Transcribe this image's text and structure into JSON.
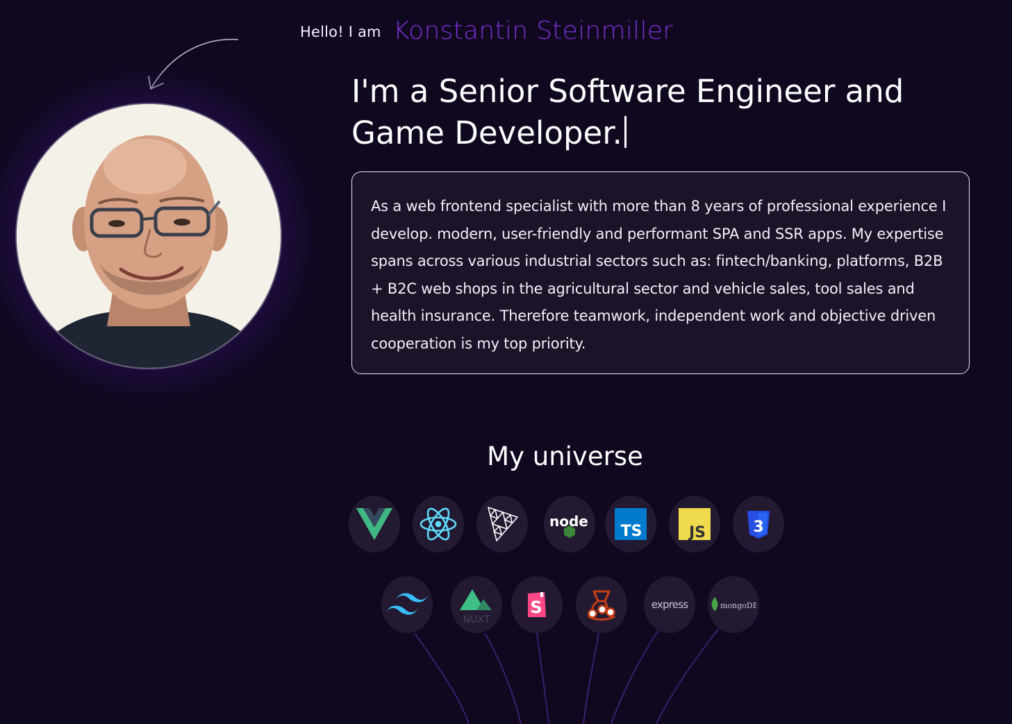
{
  "intro": {
    "greeting": "Hello! I am",
    "name": "Konstantin Steinmiller",
    "avatar_alt": "Portrait of Konstantin Steinmiller"
  },
  "headline": {
    "line1": "I'm a Senior Software Engineer and",
    "line2": "Game Developer."
  },
  "bio": {
    "text": "As a web frontend specialist with more than 8 years of professional experience I develop. modern, user-friendly and performant SPA and SSR apps. My expertise spans across various industrial sectors such as: fintech/banking, platforms, B2B + B2C web shops in the agricultural sector and vehicle sales, tool sales and health insurance. Therefore teamwork, independent work and objective driven cooperation is my top priority."
  },
  "universe": {
    "title": "My universe",
    "row1": [
      {
        "icon": "vue-icon"
      },
      {
        "icon": "react-icon"
      },
      {
        "icon": "threejs-icon"
      },
      {
        "icon": "nodejs-icon",
        "label": "node"
      },
      {
        "icon": "typescript-icon",
        "label": "TS"
      },
      {
        "icon": "javascript-icon",
        "label": "JS"
      },
      {
        "icon": "css3-icon",
        "label": "3"
      }
    ],
    "row2": [
      {
        "icon": "tailwind-icon"
      },
      {
        "icon": "nuxt-icon",
        "label": "NUXT"
      },
      {
        "icon": "storybook-icon",
        "label": "S"
      },
      {
        "icon": "jest-icon"
      },
      {
        "icon": "express-icon",
        "label": "express"
      },
      {
        "icon": "mongodb-icon",
        "label": "mongoDB"
      }
    ]
  },
  "colors": {
    "background": "#10081f",
    "accent": "#7a2fd6",
    "card": "#1b1428",
    "bubble": "#231a32"
  }
}
